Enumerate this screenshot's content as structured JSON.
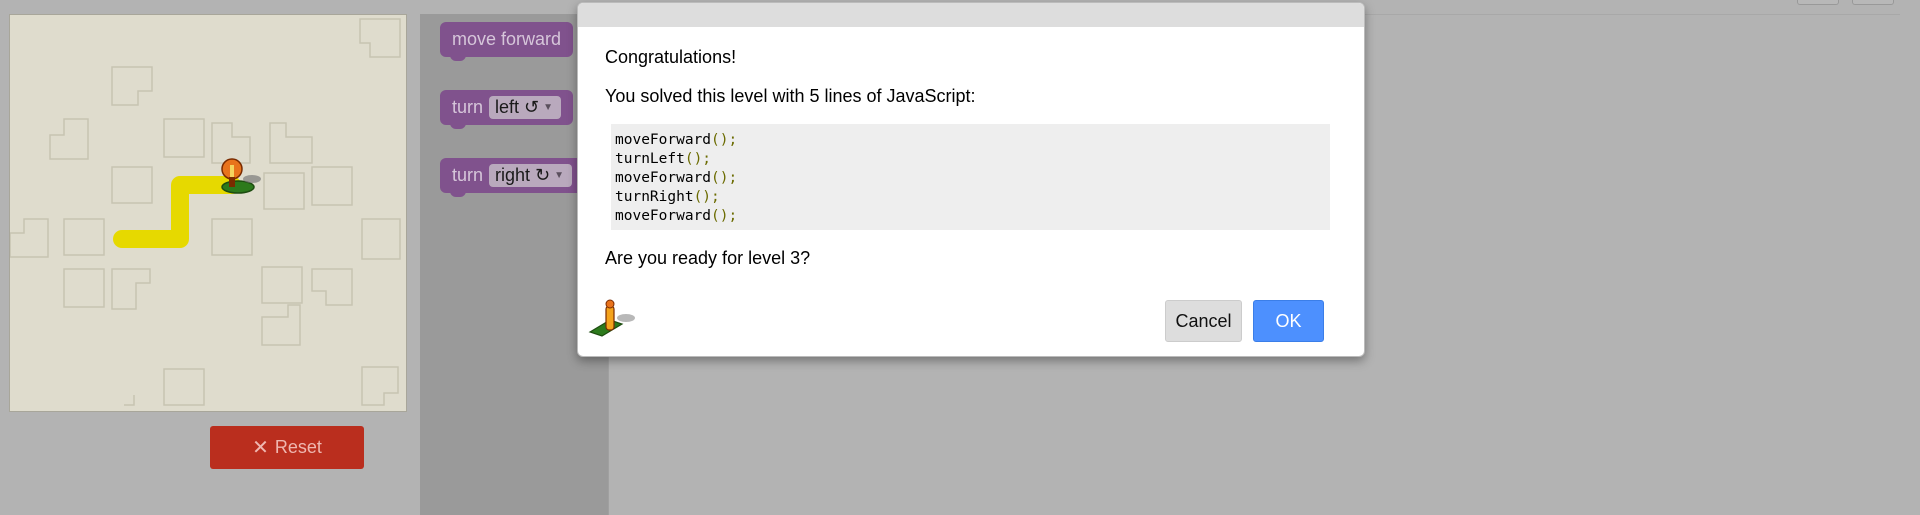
{
  "toolbox": {
    "blocks": [
      {
        "text": "move forward"
      },
      {
        "text": "turn",
        "dropdown": "left ↺"
      },
      {
        "text": "turn",
        "dropdown": "right ↻"
      }
    ]
  },
  "controls": {
    "reset_label": "Reset"
  },
  "dialog": {
    "congrats": "Congratulations!",
    "solved_text": "You solved this level with 5 lines of JavaScript:",
    "code_lines": [
      "moveForward",
      "turnLeft",
      "moveForward",
      "turnRight",
      "moveForward"
    ],
    "code_suffix": "();",
    "question": "Are you ready for level 3?",
    "cancel_label": "Cancel",
    "ok_label": "OK"
  },
  "colors": {
    "ok_button": "#4d90fe",
    "reset_button": "#ba2e1e",
    "block": "#80528d",
    "path": "#e6d900"
  }
}
